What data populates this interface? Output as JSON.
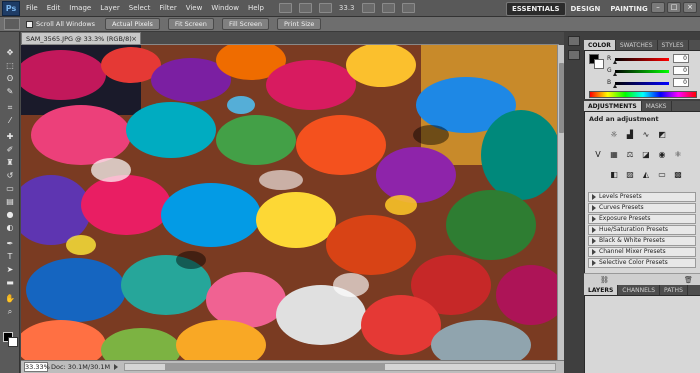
{
  "app": {
    "logo": "Ps"
  },
  "menubar": {
    "items": [
      "File",
      "Edit",
      "Image",
      "Layer",
      "Select",
      "Filter",
      "View",
      "Window",
      "Help"
    ],
    "zoom": "33.3",
    "workspaces": [
      "ESSENTIALS",
      "DESIGN",
      "PAINTING"
    ],
    "more": "»",
    "window_controls": [
      "–",
      "□",
      "×"
    ]
  },
  "options": {
    "scroll_all_label": "Scroll All Windows",
    "buttons": [
      "Actual Pixels",
      "Fit Screen",
      "Fill Screen",
      "Print Size"
    ]
  },
  "document": {
    "tab_title": "SAM_3565.JPG @ 33.3% (RGB/8)",
    "close": "×",
    "zoom": "33.33%",
    "doc_info": "Doc: 30.1M/30.1M"
  },
  "color_panel": {
    "tabs": [
      "COLOR",
      "SWATCHES",
      "STYLES"
    ],
    "sliders": [
      {
        "label": "R",
        "value": "0"
      },
      {
        "label": "G",
        "value": "0"
      },
      {
        "label": "B",
        "value": "0"
      }
    ]
  },
  "adjustments_panel": {
    "tabs": [
      "ADJUSTMENTS",
      "MASKS"
    ],
    "heading": "Add an adjustment",
    "presets": [
      "Levels Presets",
      "Curves Presets",
      "Exposure Presets",
      "Hue/Saturation Presets",
      "Black & White Presets",
      "Channel Mixer Presets",
      "Selective Color Presets"
    ]
  },
  "layers_panel": {
    "tabs": [
      "LAYERS",
      "CHANNELS",
      "PATHS"
    ]
  },
  "tools": [
    "move",
    "marquee",
    "lasso",
    "quick-select",
    "crop",
    "eyedropper",
    "healing",
    "brush",
    "clone",
    "history",
    "eraser",
    "gradient",
    "blur",
    "dodge",
    "pen",
    "type",
    "path-select",
    "shape",
    "hand",
    "zoom"
  ]
}
